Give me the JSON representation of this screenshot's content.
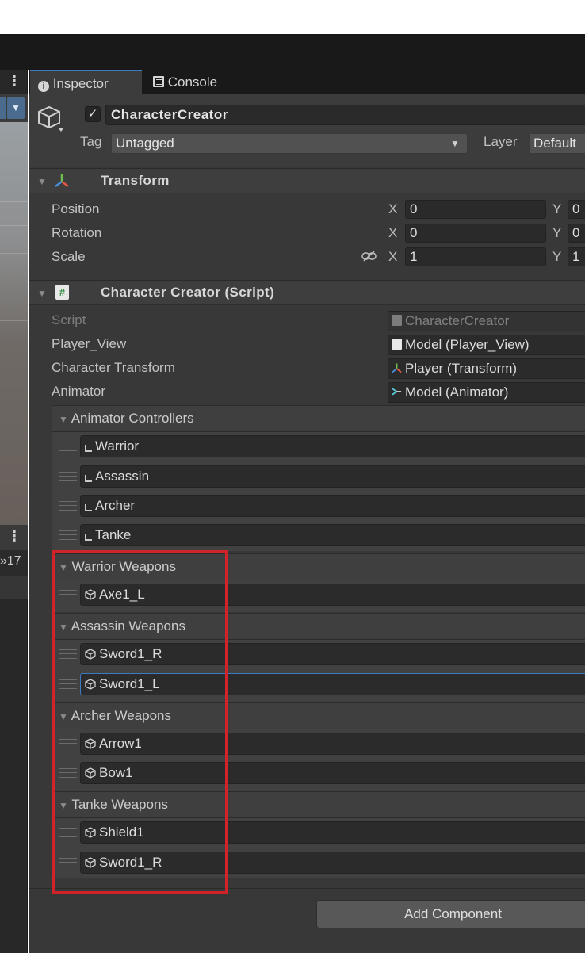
{
  "tabs": [
    {
      "label": "Inspector",
      "icon": "info-icon",
      "active": true
    },
    {
      "label": "Console",
      "icon": "console-icon",
      "active": false
    }
  ],
  "left_panel": {
    "row_value": "»17"
  },
  "object": {
    "enabled": true,
    "name": "CharacterCreator",
    "tag_label": "Tag",
    "tag_value": "Untagged",
    "layer_label": "Layer",
    "layer_value": "Default"
  },
  "transform": {
    "title": "Transform",
    "rows": [
      {
        "label": "Position",
        "x": "0",
        "y": "0"
      },
      {
        "label": "Rotation",
        "x": "0",
        "y": "0"
      },
      {
        "label": "Scale",
        "x": "1",
        "y": "1"
      }
    ],
    "axis_x": "X",
    "axis_y": "Y"
  },
  "script_component": {
    "title": "Character Creator (Script)",
    "fields": [
      {
        "label": "Script",
        "value": "CharacterCreator",
        "icon": "script-icon"
      },
      {
        "label": "Player_View",
        "value": "Model (Player_View)",
        "icon": "script-icon"
      },
      {
        "label": "Character Transform",
        "value": "Player (Transform)",
        "icon": "transform-icon"
      },
      {
        "label": "Animator",
        "value": "Model (Animator)",
        "icon": "animator-icon"
      }
    ]
  },
  "lists": {
    "animator_controllers": {
      "title": "Animator Controllers",
      "items": [
        "Warrior",
        "Assassin",
        "Archer",
        "Tanke"
      ]
    },
    "warrior_weapons": {
      "title": "Warrior Weapons",
      "items": [
        "Axe1_L"
      ]
    },
    "assassin_weapons": {
      "title": "Assassin Weapons",
      "items": [
        "Sword1_R",
        "Sword1_L"
      ]
    },
    "archer_weapons": {
      "title": "Archer Weapons",
      "items": [
        "Arrow1",
        "Bow1"
      ]
    },
    "tanke_weapons": {
      "title": "Tanke Weapons",
      "items": [
        "Shield1",
        "Sword1_R"
      ]
    }
  },
  "add_component": "Add Component",
  "colors": {
    "highlight_box": "#d0232a",
    "selection": "#3d7ac2",
    "accent_tab": "#3a79bb"
  }
}
